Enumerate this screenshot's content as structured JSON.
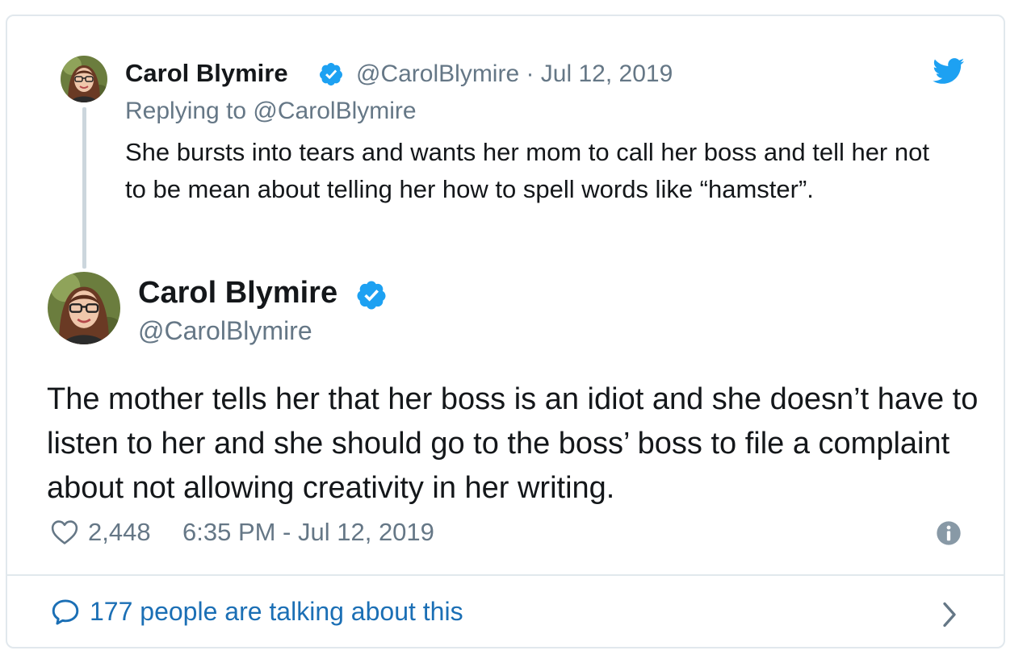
{
  "parent_tweet": {
    "author_name": "Carol Blymire",
    "verified_icon": "verified-badge-icon",
    "meta": "@CarolBlymire · Jul 12, 2019",
    "replying_to": "Replying to @CarolBlymire",
    "text": "She bursts into tears and wants her mom to call her boss and tell her not to be mean about telling her how to spell words like “hamster”."
  },
  "main_tweet": {
    "author_name": "Carol Blymire",
    "handle": "@CarolBlymire",
    "text": "The mother tells her that her boss is an idiot and she doesn’t have to listen to her and she should go to the boss’ boss to file a complaint about not allowing creativity in her writing.",
    "likes": "2,448",
    "timestamp": "6:35 PM - Jul 12, 2019"
  },
  "footer": {
    "talking": "177 people are talking about this"
  },
  "icons": {
    "brand": "twitter-bird-icon",
    "like": "heart-icon",
    "info": "info-icon",
    "reply": "speech-bubble-icon",
    "chevron": "chevron-right-icon"
  },
  "colors": {
    "twitter_blue": "#1da1f2",
    "verified_blue": "#1da1f2",
    "secondary_text": "#657786",
    "link": "#1b6fb5",
    "border": "#e1e8ed"
  }
}
